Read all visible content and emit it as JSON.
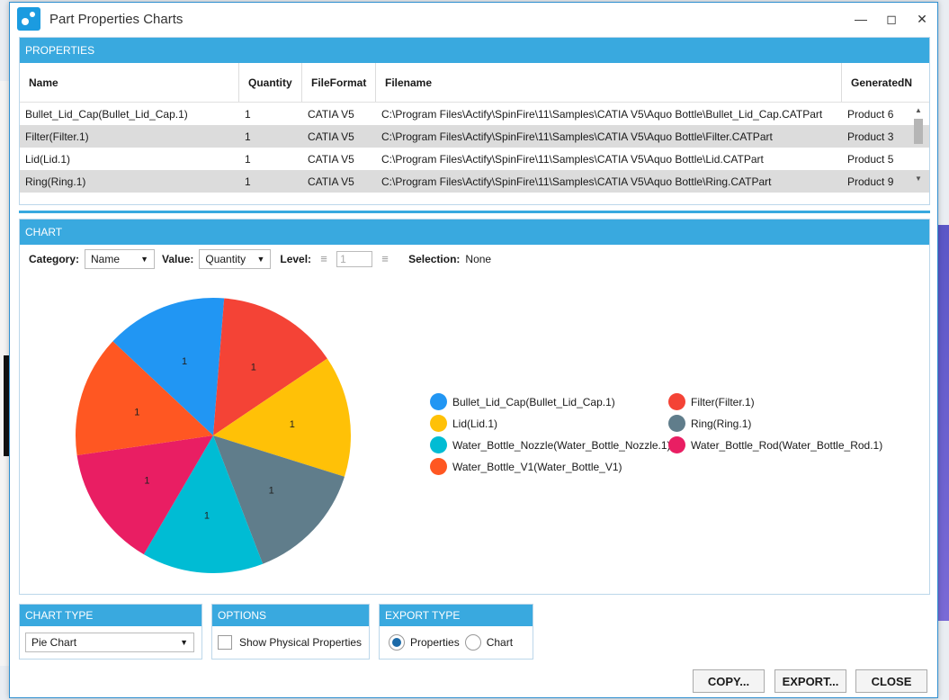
{
  "window": {
    "title": "Part Properties Charts"
  },
  "properties": {
    "header": "PROPERTIES",
    "columns": [
      "Name",
      "Quantity",
      "FileFormat",
      "Filename",
      "GeneratedN"
    ],
    "rows": [
      [
        "Bullet_Lid_Cap(Bullet_Lid_Cap.1)",
        "1",
        "CATIA V5",
        "C:\\Program Files\\Actify\\SpinFire\\11\\Samples\\CATIA V5\\Aquo Bottle\\Bullet_Lid_Cap.CATPart",
        "Product 6"
      ],
      [
        "Filter(Filter.1)",
        "1",
        "CATIA V5",
        "C:\\Program Files\\Actify\\SpinFire\\11\\Samples\\CATIA V5\\Aquo Bottle\\Filter.CATPart",
        "Product 3"
      ],
      [
        "Lid(Lid.1)",
        "1",
        "CATIA V5",
        "C:\\Program Files\\Actify\\SpinFire\\11\\Samples\\CATIA V5\\Aquo Bottle\\Lid.CATPart",
        "Product 5"
      ],
      [
        "Ring(Ring.1)",
        "1",
        "CATIA V5",
        "C:\\Program Files\\Actify\\SpinFire\\11\\Samples\\CATIA V5\\Aquo Bottle\\Ring.CATPart",
        "Product 9"
      ]
    ]
  },
  "chart_panel": {
    "header": "CHART",
    "category_label": "Category:",
    "category_value": "Name",
    "value_label": "Value:",
    "value_value": "Quantity",
    "level_label": "Level:",
    "level_value": "1",
    "selection_label": "Selection:",
    "selection_value": "None"
  },
  "chart_data": {
    "type": "pie",
    "categories": [
      "Bullet_Lid_Cap(Bullet_Lid_Cap.1)",
      "Filter(Filter.1)",
      "Lid(Lid.1)",
      "Ring(Ring.1)",
      "Water_Bottle_Nozzle(Water_Bottle_Nozzle.1)",
      "Water_Bottle_Rod(Water_Bottle_Rod.1)",
      "Water_Bottle_V1(Water_Bottle_V1)"
    ],
    "values": [
      1,
      1,
      1,
      1,
      1,
      1,
      1
    ],
    "colors": [
      "#2196f3",
      "#f44336",
      "#ffc107",
      "#607d8b",
      "#00bcd4",
      "#e91e63",
      "#ff5722"
    ],
    "legend_position": "right"
  },
  "chart_type": {
    "header": "CHART TYPE",
    "value": "Pie Chart"
  },
  "options": {
    "header": "OPTIONS",
    "show_physical": "Show Physical Properties"
  },
  "export_type": {
    "header": "EXPORT TYPE",
    "opt1": "Properties",
    "opt2": "Chart"
  },
  "buttons": {
    "copy": "COPY...",
    "export": "EXPORT...",
    "close": "CLOSE"
  }
}
